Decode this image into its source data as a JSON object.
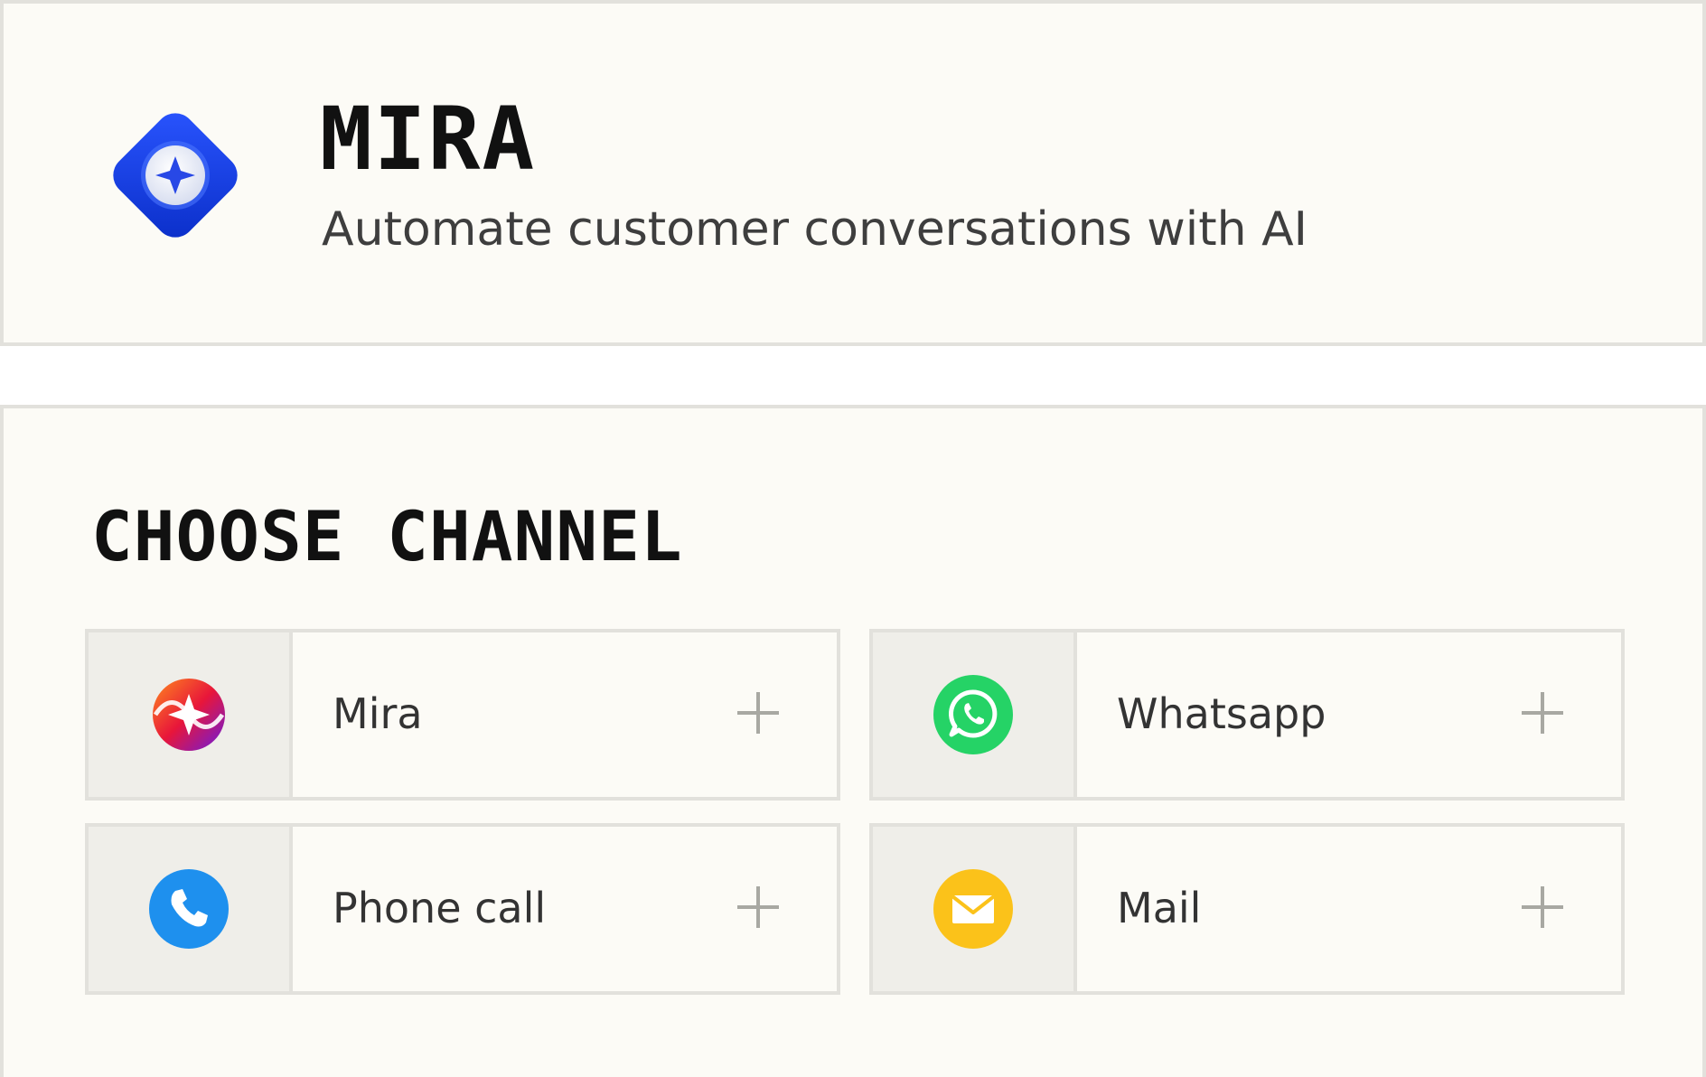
{
  "header": {
    "app_name": "MIRA",
    "tagline": "Automate customer conversations with AI",
    "logo_icon": "mira-diamond-logo",
    "logo_color": "#1a3fe0"
  },
  "channels": {
    "title": "CHOOSE CHANNEL",
    "items": [
      {
        "label": "Mira",
        "icon": "mira-icon",
        "action_icon": "plus-icon"
      },
      {
        "label": "Whatsapp",
        "icon": "whatsapp-icon",
        "color": "#25d366",
        "action_icon": "plus-icon"
      },
      {
        "label": "Phone call",
        "icon": "phone-icon",
        "color": "#1e90ee",
        "action_icon": "plus-icon"
      },
      {
        "label": "Mail",
        "icon": "mail-icon",
        "color": "#fbc21a",
        "action_icon": "plus-icon"
      }
    ]
  }
}
